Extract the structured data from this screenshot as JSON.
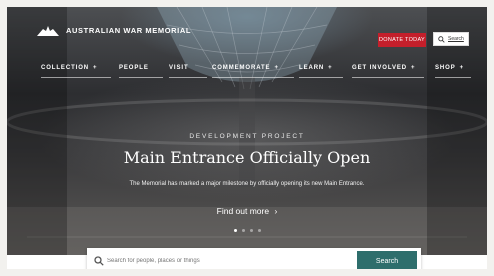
{
  "brand": {
    "name": "AUSTRALIAN WAR MEMORIAL"
  },
  "header": {
    "donate_label": "DONATE TODAY",
    "search_label": "Search"
  },
  "nav": {
    "items": [
      {
        "label": "COLLECTION",
        "plus": "+"
      },
      {
        "label": "PEOPLE",
        "plus": ""
      },
      {
        "label": "VISIT",
        "plus": ""
      },
      {
        "label": "COMMEMORATE",
        "plus": "+"
      },
      {
        "label": "LEARN",
        "plus": "+"
      },
      {
        "label": "GET INVOLVED",
        "plus": "+"
      },
      {
        "label": "SHOP",
        "plus": "+"
      }
    ]
  },
  "hero": {
    "eyebrow": "DEVELOPMENT PROJECT",
    "headline": "Main Entrance Officially Open",
    "description": "The Memorial has marked a major milestone by officially opening its new Main Entrance.",
    "cta": "Find out more",
    "cta_arrow": "›",
    "slides": {
      "count": 4,
      "active": 0
    }
  },
  "search": {
    "placeholder": "Search for people, places or things",
    "button_label": "Search"
  },
  "colors": {
    "donate": "#c41f2b",
    "search_button": "#2e6e6c"
  }
}
